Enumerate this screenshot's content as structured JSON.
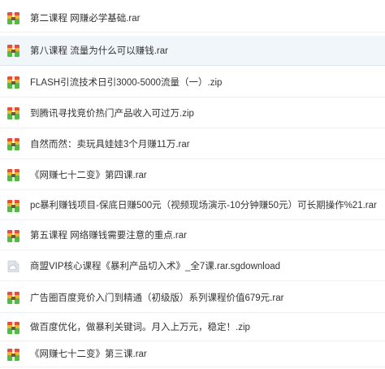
{
  "files": [
    {
      "name": "第二课程 网赚必学基础.rar",
      "icon": "archive-icon"
    },
    {
      "name": "第八课程 流量为什么可以赚钱.rar",
      "icon": "archive-icon"
    },
    {
      "name": "FLASH引流技术日引3000-5000流量（一）.zip",
      "icon": "archive-icon"
    },
    {
      "name": "到腾讯寻找竞价热门产品收入可过万.zip",
      "icon": "archive-icon"
    },
    {
      "name": "自然而然：卖玩具娃娃3个月赚11万.rar",
      "icon": "archive-icon"
    },
    {
      "name": "《网赚七十二变》第四课.rar",
      "icon": "archive-icon"
    },
    {
      "name": "pc暴利赚钱项目-保底日赚500元（视频现场演示-10分钟赚50元）可长期操作%21.rar",
      "icon": "archive-icon"
    },
    {
      "name": "第五课程 网络赚钱需要注意的重点.rar",
      "icon": "archive-icon"
    },
    {
      "name": "商盟VIP核心课程《暴利产品切入术》_全7课.rar.sgdownload",
      "icon": "cloud-file-icon"
    },
    {
      "name": "广告圈百度竞价入门到精通（初级版）系列课程价值679元.rar",
      "icon": "archive-icon"
    },
    {
      "name": "做百度优化，做暴利关键词。月入上万元，稳定！.zip",
      "icon": "archive-icon"
    },
    {
      "name": "《网赚七十二变》第三课.rar",
      "icon": "archive-icon"
    }
  ],
  "colors": {
    "archive_band_1": "#e0503c",
    "archive_band_2": "#f2b624",
    "archive_band_3": "#3f95d6",
    "archive_band_4": "#56b847",
    "selected_row": "#f1f6fb",
    "text": "#333333"
  }
}
